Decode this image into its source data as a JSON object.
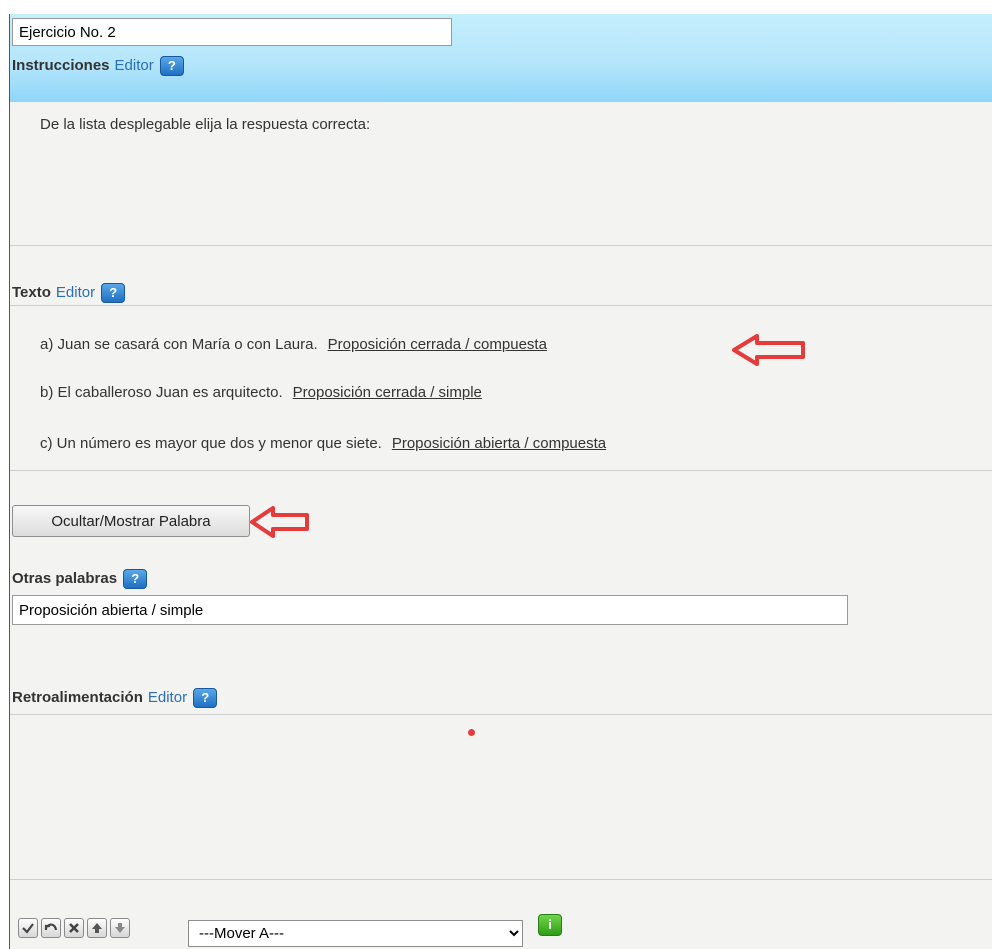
{
  "exercise_title": "Ejercicio No. 2",
  "instructions": {
    "label": "Instrucciones",
    "editor_link": "Editor",
    "text": "De la lista desplegable elija la respuesta correcta:"
  },
  "texto": {
    "label": "Texto",
    "editor_link": "Editor",
    "items": [
      {
        "prefix": "a)  Juan se casará con María o con Laura.",
        "answer": "Proposición  cerrada / compuesta"
      },
      {
        "prefix": "b) El caballeroso Juan es arquitecto.",
        "answer": "Proposición cerrada / simple"
      },
      {
        "prefix": "c) Un número es mayor que dos y menor que siete.",
        "answer": "Proposición abierta / compuesta"
      }
    ]
  },
  "toggle_button_label": "Ocultar/Mostrar Palabra",
  "otras_palabras": {
    "label": "Otras palabras",
    "value": "Proposición abierta / simple"
  },
  "retroalimentacion": {
    "label": "Retroalimentación",
    "editor_link": "Editor"
  },
  "help_icon_glyph": "?",
  "toolbar": {
    "icons": [
      "check-icon",
      "undo-icon",
      "delete-icon",
      "move-up-icon",
      "move-down-icon"
    ],
    "move_select_value": "---Mover A---",
    "info_icon": "info-icon"
  },
  "colors": {
    "header_top": "#c4eefc",
    "header_bottom": "#8fd6f8",
    "annotation_arrow": "#e53b3b",
    "link": "#2a6fb5"
  }
}
